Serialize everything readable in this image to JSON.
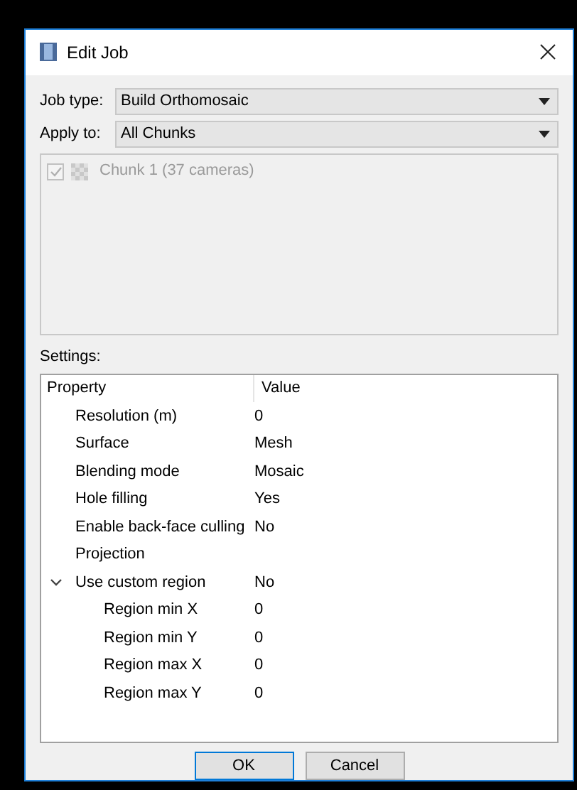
{
  "window": {
    "title": "Edit Job"
  },
  "fields": [
    {
      "label": "Job type:",
      "value": "Build Orthomosaic"
    },
    {
      "label": "Apply to:",
      "value": "All Chunks"
    }
  ],
  "chunks": [
    {
      "label": "Chunk 1 (37 cameras)",
      "checked": true,
      "disabled": true
    }
  ],
  "settings": {
    "label": "Settings:",
    "columns": [
      "Property",
      "Value"
    ],
    "rows": [
      {
        "property": "Resolution (m)",
        "value": "0"
      },
      {
        "property": "Surface",
        "value": "Mesh"
      },
      {
        "property": "Blending mode",
        "value": "Mosaic"
      },
      {
        "property": "Hole filling",
        "value": "Yes"
      },
      {
        "property": "Enable back-face culling",
        "value": "No"
      },
      {
        "property": "Projection"
      },
      {
        "property": "Use custom region",
        "value": "No",
        "expanded": true,
        "children": [
          {
            "property": "Region min X",
            "value": "0"
          },
          {
            "property": "Region min Y",
            "value": "0"
          },
          {
            "property": "Region max X",
            "value": "0"
          },
          {
            "property": "Region max Y",
            "value": "0"
          }
        ]
      }
    ]
  },
  "buttons": [
    {
      "label": "OK",
      "selected": true
    },
    {
      "label": "Cancel",
      "selected": false
    }
  ]
}
